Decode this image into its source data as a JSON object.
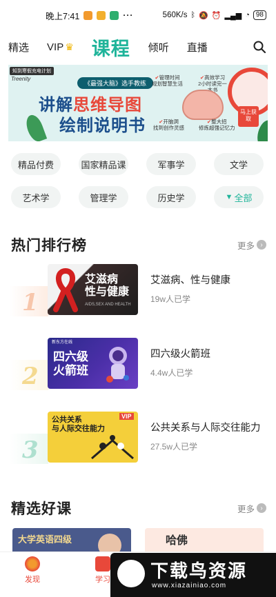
{
  "status_bar": {
    "time": "晚上7:41",
    "dots": "···",
    "network_speed": "560K/s",
    "battery": "98",
    "icons": [
      "app-icon-orange",
      "app-icon-orange",
      "app-icon-green",
      "bluetooth-icon",
      "mute-icon",
      "alarm-icon",
      "signal-icon",
      "wifi-icon",
      "battery-icon"
    ]
  },
  "top_nav": {
    "items": [
      "精选",
      "VIP",
      "课程",
      "倾听",
      "直播"
    ],
    "active": "课程",
    "icons": {
      "vip": "crown-icon",
      "search": "search-icon"
    },
    "colors": {
      "active": "#1fb49a",
      "crown": "#f0b400"
    }
  },
  "banner": {
    "tag": "知到寒假充电计划",
    "logo": "Treenity",
    "pill": "《最强大脑》选手教练",
    "title_line1_a": "讲解",
    "title_line1_b": "思维导图",
    "title_line2": "绘制说明书",
    "features": [
      {
        "label": "管理时间",
        "sub": "规划智慧生活"
      },
      {
        "label": "高效学习",
        "sub": "2小时读完一本书"
      },
      {
        "label": "开脑洞",
        "sub": "找到创作灵感"
      },
      {
        "label": "整大招",
        "sub": "修炼超强记忆力"
      }
    ],
    "cta": "马上获取",
    "check_glyph": "✔"
  },
  "categories": [
    "精品付费",
    "国家精品课",
    "军事学",
    "文学",
    "艺术学",
    "管理学",
    "历史学",
    "全部"
  ],
  "category_all_icon": "funnel-icon",
  "hot_ranking": {
    "title": "热门排行榜",
    "more": "更多",
    "items": [
      {
        "rank": "1",
        "title": "艾滋病、性与健康",
        "learners": "19w人已学",
        "thumb_text": "艾滋病\n性与健康",
        "thumb_sub": "AIDS,SEX AND HEALTH"
      },
      {
        "rank": "2",
        "title": "四六级火箭班",
        "learners": "4.4w人已学",
        "thumb_text": "四六级\n火箭班",
        "thumb_sub": "新东方在线"
      },
      {
        "rank": "3",
        "title": "公共关系与人际交往能力",
        "learners": "27.5w人已学",
        "thumb_text": "公共关系\n与人际交往能力",
        "thumb_sub": "VIP"
      }
    ]
  },
  "featured": {
    "title": "精选好课",
    "more": "更多",
    "cards": [
      {
        "text": "大学英语四级"
      },
      {
        "text": "哈佛"
      }
    ]
  },
  "tabbar": {
    "items": [
      {
        "label": "发现",
        "icon": "discover-icon"
      },
      {
        "label": "学习",
        "icon": "study-icon"
      }
    ],
    "active": "发现",
    "active_color": "#e8483a"
  },
  "watermark": {
    "cn": "下载鸟资源",
    "en": "www.xiazainiao.com"
  }
}
